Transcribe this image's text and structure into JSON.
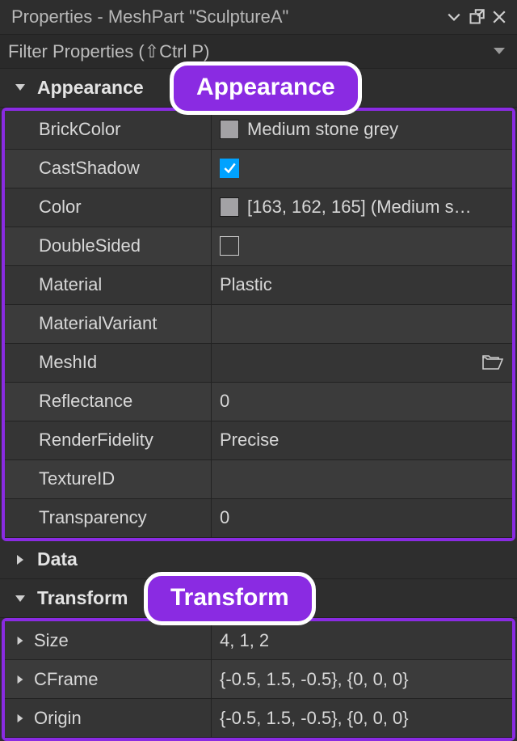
{
  "titlebar": {
    "title": "Properties - MeshPart \"SculptureA\""
  },
  "filter": {
    "placeholder": "Filter Properties (⇧Ctrl P)"
  },
  "callouts": {
    "appearance": "Appearance",
    "transform": "Transform"
  },
  "sections": {
    "appearance": {
      "label": "Appearance",
      "expanded": true,
      "rows": [
        {
          "name": "BrickColor",
          "swatch": "#a3a2a5",
          "value": "Medium stone grey"
        },
        {
          "name": "CastShadow",
          "checkbox": true,
          "checked": true
        },
        {
          "name": "Color",
          "swatch": "#a3a2a5",
          "value": "[163, 162, 165] (Medium s…"
        },
        {
          "name": "DoubleSided",
          "checkbox": true,
          "checked": false
        },
        {
          "name": "Material",
          "value": "Plastic"
        },
        {
          "name": "MaterialVariant",
          "value": ""
        },
        {
          "name": "MeshId",
          "value": "",
          "folder": true
        },
        {
          "name": "Reflectance",
          "value": "0"
        },
        {
          "name": "RenderFidelity",
          "value": "Precise"
        },
        {
          "name": "TextureID",
          "value": ""
        },
        {
          "name": "Transparency",
          "value": "0"
        }
      ]
    },
    "data": {
      "label": "Data",
      "expanded": false
    },
    "transform": {
      "label": "Transform",
      "expanded": true,
      "rows": [
        {
          "name": "Size",
          "value": "4, 1, 2",
          "expandable": true
        },
        {
          "name": "CFrame",
          "value": "{-0.5, 1.5, -0.5}, {0, 0, 0}",
          "expandable": true
        },
        {
          "name": "Origin",
          "value": "{-0.5, 1.5, -0.5}, {0, 0, 0}",
          "expandable": true
        }
      ]
    }
  }
}
